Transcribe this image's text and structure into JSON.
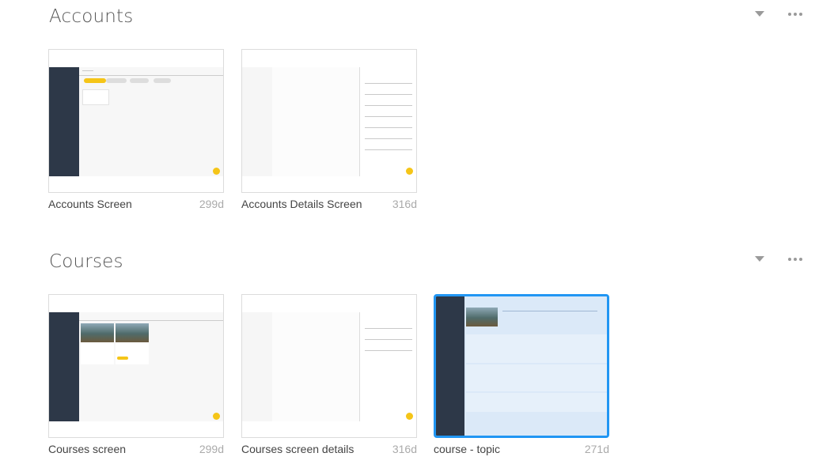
{
  "sections": [
    {
      "title": "Accounts",
      "cards": [
        {
          "label": "Accounts Screen",
          "age": "299d"
        },
        {
          "label": "Accounts Details Screen",
          "age": "316d"
        }
      ]
    },
    {
      "title": "Courses",
      "cards": [
        {
          "label": "Courses screen",
          "age": "299d"
        },
        {
          "label": "Courses screen details",
          "age": "316d"
        },
        {
          "label": "course - topic",
          "age": "271d"
        }
      ]
    }
  ],
  "colors": {
    "accent": "#2196f3",
    "fab": "#f5c518",
    "sidebar": "#2d3848"
  }
}
